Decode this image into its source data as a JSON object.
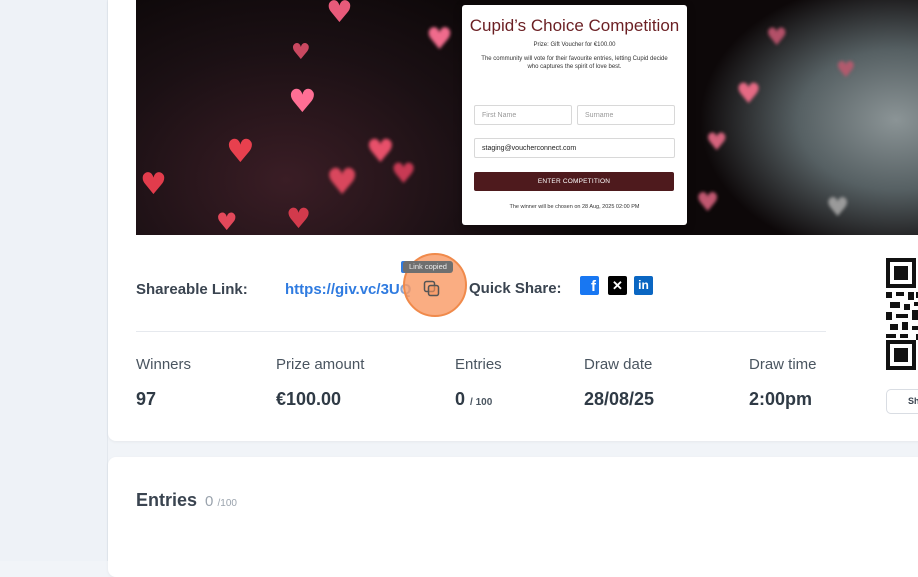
{
  "competition_form": {
    "title": "Cupid’s Choice Competition",
    "prize": "Prize: Gift Voucher for €100.00",
    "description": "The community will vote for their favourite entries, letting Cupid decide who captures the spirit of love best.",
    "first_name_placeholder": "First Name",
    "surname_placeholder": "Surname",
    "email_value": "staging@voucherconnect.com",
    "enter_button": "ENTER COMPETITION",
    "winner_note": "The winner will be chosen on 28 Aug, 2025 02:00 PM"
  },
  "share": {
    "label": "Shareable Link:",
    "link": "https://giv.vc/3U",
    "link_tail": "Q",
    "copied_tooltip": "Link copied",
    "quick_share_label": "Quick Share:",
    "icons": [
      "copy-icon",
      "facebook-icon",
      "x-icon",
      "linkedin-icon"
    ]
  },
  "stats": {
    "winners": {
      "label": "Winners",
      "value": "97"
    },
    "prize_amount": {
      "label": "Prize amount",
      "value": "€100.00"
    },
    "entries": {
      "label": "Entries",
      "value": "0",
      "sub": "/ 100"
    },
    "draw_date": {
      "label": "Draw date",
      "value": "28/08/25"
    },
    "draw_time": {
      "label": "Draw time",
      "value": "2:00pm"
    }
  },
  "qr": {
    "button_label": "Sh"
  },
  "entries_section": {
    "title": "Entries",
    "count": "0",
    "total": "/100"
  },
  "colors": {
    "accent": "#2f7be0",
    "brand_burgundy": "#4e1a1d",
    "title_red": "#6b1f23",
    "click_highlight": "#f8965f"
  }
}
